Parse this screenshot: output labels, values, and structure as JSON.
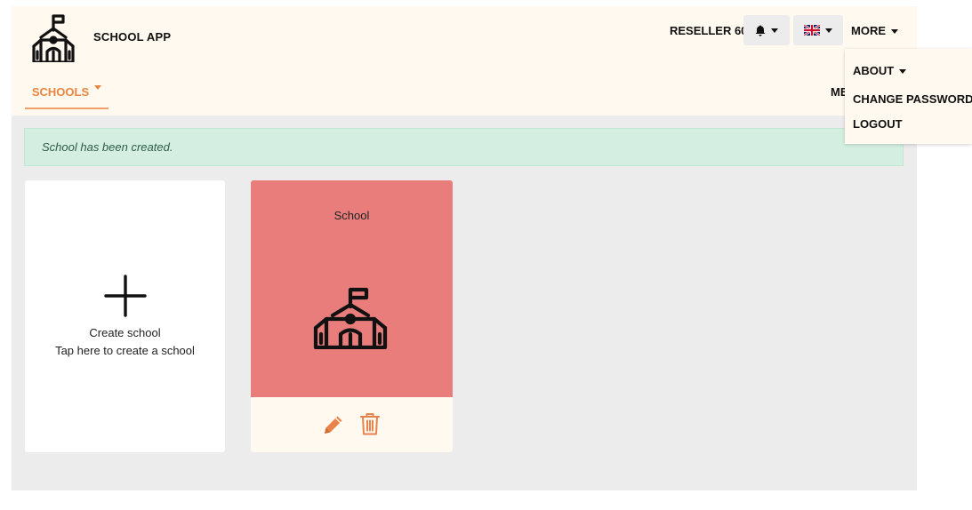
{
  "header": {
    "app_name": "SCHOOL APP",
    "logo_icon": "school-building-icon",
    "reseller": "RESELLER 60",
    "notifications_icon": "bell-icon",
    "language_icon": "uk-flag-icon",
    "more_label": "MORE"
  },
  "nav": {
    "schools_label": "SCHOOLS",
    "me_label": "ME"
  },
  "more_menu": {
    "about": "ABOUT",
    "change_password": "CHANGE PASSWORD",
    "logout": "LOGOUT"
  },
  "alert": {
    "message": "School has been created."
  },
  "create_card": {
    "icon": "plus-icon",
    "title": "Create school",
    "subtitle": "Tap here to create a school"
  },
  "schools": [
    {
      "name": "School",
      "color": "#e87d7b",
      "icon": "school-building-icon",
      "actions": [
        "edit-icon",
        "delete-icon"
      ]
    }
  ],
  "colors": {
    "accent": "#e78640",
    "header_bg": "#fff9ef",
    "alert_bg": "#d4efe1",
    "school_card": "#e87d7b"
  }
}
